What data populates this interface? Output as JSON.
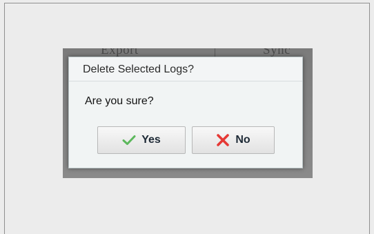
{
  "background_app": {
    "column_left_label": "Export",
    "column_right_label": "Sync"
  },
  "dialog": {
    "title": "Delete Selected Logs?",
    "message": "Are you sure?",
    "yes_button": {
      "label": "Yes",
      "icon": "checkmark-icon",
      "icon_color": "#5cb85c"
    },
    "no_button": {
      "label": "No",
      "icon": "close-x-icon",
      "icon_color": "#e53935"
    }
  }
}
